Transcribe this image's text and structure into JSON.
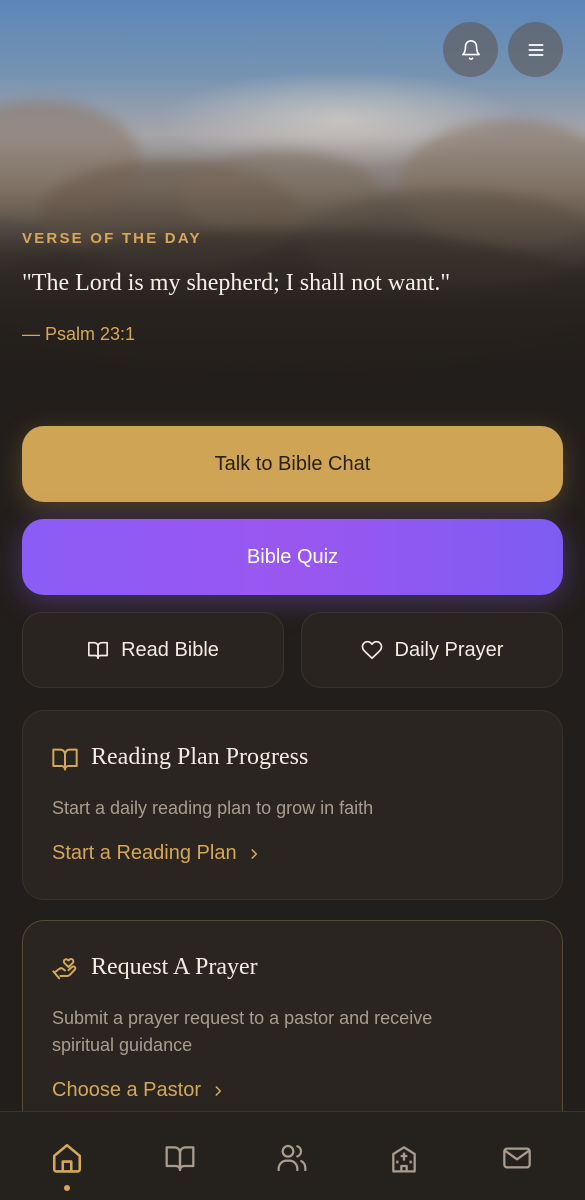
{
  "header": {
    "bell_icon": "bell-icon",
    "menu_icon": "menu-icon"
  },
  "verse": {
    "label": "VERSE OF THE DAY",
    "text": "\"The Lord is my shepherd; I shall not want.\"",
    "reference": "— Psalm 23:1"
  },
  "actions": {
    "chat_label": "Talk to Bible Chat",
    "quiz_label": "Bible Quiz",
    "read_label": "Read Bible",
    "prayer_label": "Daily Prayer"
  },
  "reading_plan": {
    "title": "Reading Plan Progress",
    "description": "Start a daily reading plan to grow in faith",
    "link": "Start a Reading Plan"
  },
  "prayer_request": {
    "title": "Request A Prayer",
    "description_line1": "Submit a prayer request to a pastor and receive",
    "description_line2": "spiritual guidance",
    "link": "Choose a Pastor"
  },
  "nav": {
    "items": [
      "home-icon",
      "bible-icon",
      "community-icon",
      "church-icon",
      "mail-icon"
    ],
    "active": "home-icon"
  },
  "colors": {
    "background": "#221e1b",
    "gold": "#d5a75a",
    "primary_button": "#d0a455",
    "quiz_button": "#8b5cf6"
  }
}
